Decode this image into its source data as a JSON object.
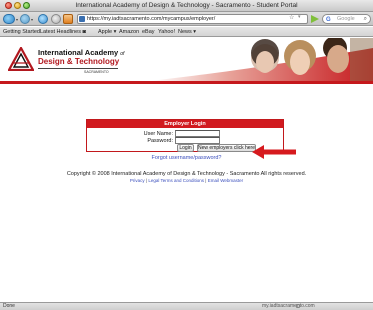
{
  "window": {
    "title": "International Academy of Design & Technology - Sacramento - Student Portal"
  },
  "toolbar": {
    "url": "https://my.iadtsacramento.com/mycampus/employer/",
    "search_placeholder": "Google",
    "search_engine_icon": "G"
  },
  "bookmarks": [
    "Getting Started",
    "Latest Headlines ◙",
    "Apple ▾",
    "Amazon",
    "eBay",
    "Yahoo!",
    "News ▾"
  ],
  "header": {
    "logo_line1": "International Academy",
    "logo_of": "of",
    "logo_line2": "Design & Technology",
    "logo_line3": "SACRAMENTO"
  },
  "login": {
    "title": "Employer Login",
    "username_label": "User Name:",
    "password_label": "Password:",
    "username_value": "",
    "password_value": "",
    "login_button": "Login",
    "new_employers_button": "New employers click here"
  },
  "forgot_link": "Forgot username/password?",
  "footer": {
    "copyright": "Copyright © 2008 International Academy of Design & Technology - Sacramento All rights reserved.",
    "privacy": "Privacy",
    "legal": "Legal Terms and Conditions",
    "email": "Email Webmaster"
  },
  "status": {
    "left": "Done",
    "right": "my.iadtsacramento.com"
  },
  "colors": {
    "brand_red": "#c5181c",
    "link_blue": "#3b4fbd"
  }
}
